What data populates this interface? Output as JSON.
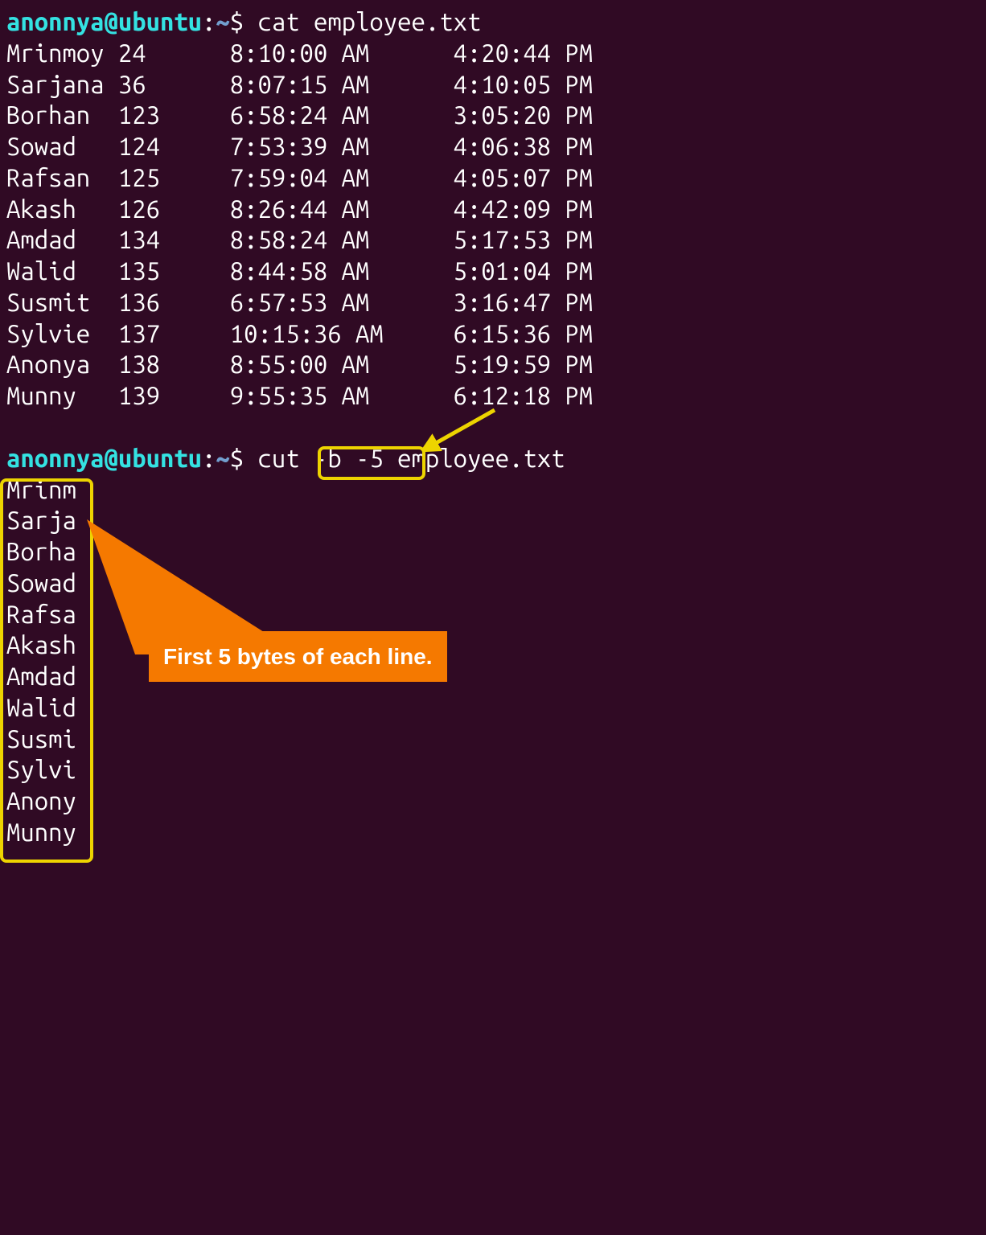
{
  "prompt1": {
    "user": "anonnya@ubuntu",
    "path": "~",
    "symbol": "$",
    "command": "cat employee.txt"
  },
  "table": {
    "rows": [
      {
        "name": "Mrinmoy",
        "id": "24",
        "in": "8:10:00 AM",
        "out": "4:20:44 PM"
      },
      {
        "name": "Sarjana",
        "id": "36",
        "in": "8:07:15 AM",
        "out": "4:10:05 PM"
      },
      {
        "name": "Borhan",
        "id": "123",
        "in": "6:58:24 AM",
        "out": "3:05:20 PM"
      },
      {
        "name": "Sowad",
        "id": "124",
        "in": "7:53:39 AM",
        "out": "4:06:38 PM"
      },
      {
        "name": "Rafsan",
        "id": "125",
        "in": "7:59:04 AM",
        "out": "4:05:07 PM"
      },
      {
        "name": "Akash",
        "id": "126",
        "in": "8:26:44 AM",
        "out": "4:42:09 PM"
      },
      {
        "name": "Amdad",
        "id": "134",
        "in": "8:58:24 AM",
        "out": "5:17:53 PM"
      },
      {
        "name": "Walid",
        "id": "135",
        "in": "8:44:58 AM",
        "out": "5:01:04 PM"
      },
      {
        "name": "Susmit",
        "id": "136",
        "in": "6:57:53 AM",
        "out": "3:16:47 PM"
      },
      {
        "name": "Sylvie",
        "id": "137",
        "in": "10:15:36 AM",
        "out": "6:15:36 PM"
      },
      {
        "name": "Anonya",
        "id": "138",
        "in": "8:55:00 AM",
        "out": "5:19:59 PM"
      },
      {
        "name": "Munny",
        "id": "139",
        "in": "9:55:35 AM",
        "out": "6:12:18 PM"
      }
    ]
  },
  "prompt2": {
    "user": "anonnya@ubuntu",
    "path": "~",
    "symbol": "$",
    "command_pre": "cut ",
    "command_hl": "-b -5",
    "command_post": " employee.txt"
  },
  "cut_output": [
    "Mrinm",
    "Sarja",
    "Borha",
    "Sowad",
    "Rafsa",
    "Akash",
    "Amdad",
    "Walid",
    "Susmi",
    "Sylvi",
    "Anony",
    "Munny"
  ],
  "annotations": {
    "callout_text": "First 5 bytes of each line."
  },
  "colors": {
    "bg": "#300a24",
    "user": "#34e2e2",
    "path": "#729fcf",
    "text": "#ffffff",
    "highlight": "#edd400",
    "callout_bg": "#f57900"
  }
}
